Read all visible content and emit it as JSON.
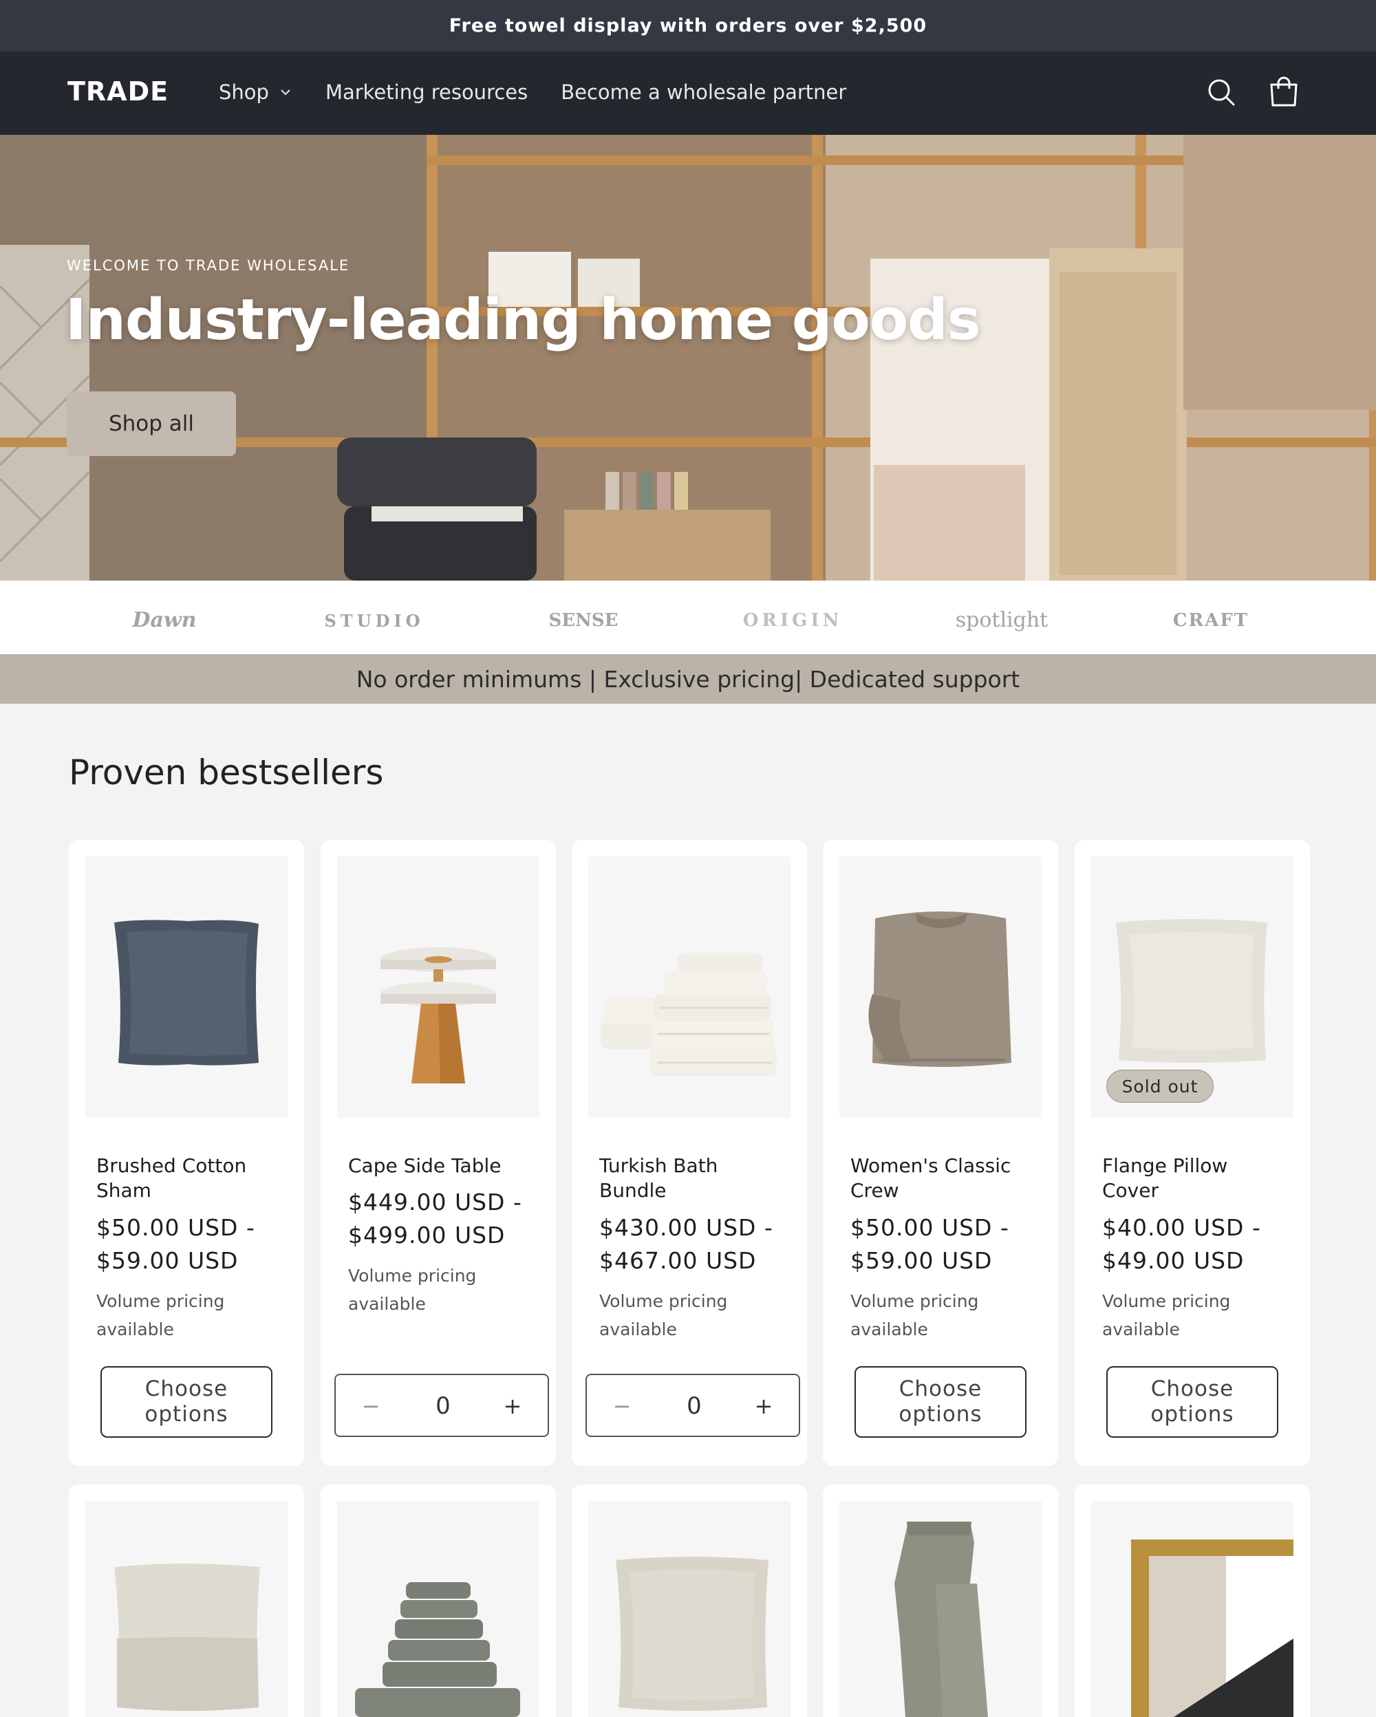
{
  "announcement": {
    "text": "Free towel display with orders over $2,500"
  },
  "header": {
    "logo": "TRADE",
    "nav": [
      {
        "label": "Shop",
        "has_dropdown": true
      },
      {
        "label": "Marketing resources"
      },
      {
        "label": "Become a wholesale partner"
      }
    ],
    "icons": [
      "search-icon",
      "cart-icon"
    ]
  },
  "hero": {
    "eyebrow": "WELCOME TO TRADE WHOLESALE",
    "title": "Industry-leading home goods",
    "button": "Shop all"
  },
  "brands": [
    "Dawn",
    "STUDIO",
    "SENSE",
    "ORIGIN",
    "spotlight",
    "CRAFT"
  ],
  "usp": {
    "text": "No order minimums | Exclusive pricing| Dedicated support"
  },
  "section": {
    "title": "Proven bestsellers"
  },
  "products": [
    {
      "name": "Brushed Cotton Sham",
      "price_from": "$50.00 USD -",
      "price_to": "$59.00 USD",
      "volume": "Volume pricing available",
      "action": "Choose options"
    },
    {
      "name": "Cape Side Table",
      "price_from": "$449.00 USD -",
      "price_to": "$499.00 USD",
      "volume": "Volume pricing available",
      "quantity": "0"
    },
    {
      "name": "Turkish Bath Bundle",
      "price_from": "$430.00 USD -",
      "price_to": "$467.00 USD",
      "volume": "Volume pricing available",
      "quantity": "0"
    },
    {
      "name": "Women's Classic Crew",
      "price_from": "$50.00 USD -",
      "price_to": "$59.00 USD",
      "volume": "Volume pricing available",
      "action": "Choose options"
    },
    {
      "name": "Flange Pillow Cover",
      "price_from": "$40.00 USD -",
      "price_to": "$49.00 USD",
      "volume": "Volume pricing available",
      "action": "Choose options",
      "badge": "Sold out"
    }
  ],
  "colors": {
    "announcement_bg": "#333842",
    "header_bg": "#24272d",
    "usp_bg": "#bbb3a8",
    "hero_button_bg": "#c4b9ae"
  }
}
